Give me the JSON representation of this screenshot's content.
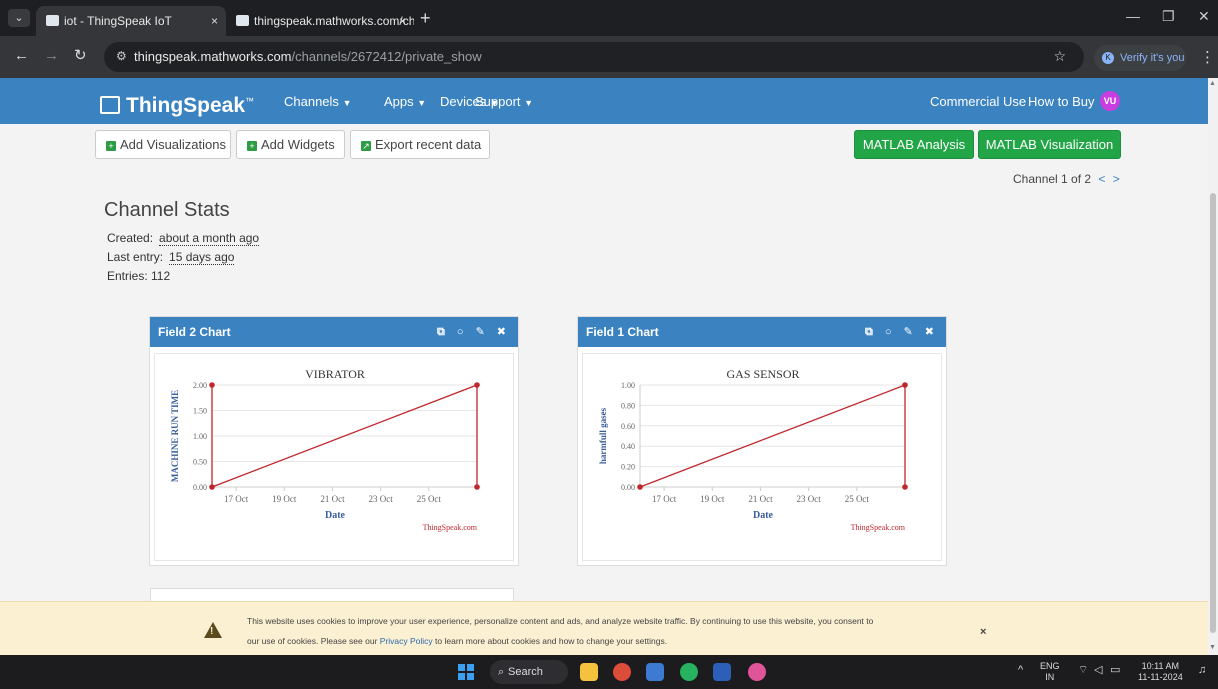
{
  "browser": {
    "tabs": [
      {
        "title": "iot - ThingSpeak IoT",
        "close": "×"
      },
      {
        "title": "thingspeak.mathworks.com/cha",
        "close": "×"
      }
    ],
    "new_tab": "+",
    "url_host": "thingspeak.mathworks.com",
    "url_path": "/channels/2672412/private_show",
    "verify_label": "Verify it's you",
    "verify_initial": "K"
  },
  "navbar": {
    "logo": "ThingSpeak",
    "logo_tm": "™",
    "menus": [
      "Channels",
      "Apps",
      "Devices",
      "Support"
    ],
    "commercial": "Commercial Use",
    "how_to_buy": "How to Buy",
    "avatar": "VU"
  },
  "toolbar": {
    "add_visualizations": "Add Visualizations",
    "add_widgets": "Add Widgets",
    "export": "Export recent data",
    "matlab_analysis": "MATLAB Analysis",
    "matlab_visualization": "MATLAB Visualization",
    "channel_nav": "Channel 1 of 2",
    "prev": "<",
    "next": ">"
  },
  "stats": {
    "title": "Channel Stats",
    "created_label": "Created:",
    "created_value": "about a month ago",
    "last_entry_label": "Last entry:",
    "last_entry_value": "15 days ago",
    "entries": "Entries: 112"
  },
  "chart_data": [
    {
      "type": "line",
      "panel_title": "Field 2 Chart",
      "title": "VIBRATOR",
      "xlabel": "Date",
      "ylabel": "MACHINE RUN TIME",
      "credit": "ThingSpeak.com",
      "x_ticks": [
        "17 Oct",
        "19 Oct",
        "21 Oct",
        "23 Oct",
        "25 Oct"
      ],
      "y_ticks": [
        "0.00",
        "0.50",
        "1.00",
        "1.50",
        "2.00"
      ],
      "ylim": [
        0,
        2
      ],
      "points": [
        {
          "x": "16 Oct",
          "y": 2
        },
        {
          "x": "16 Oct",
          "y": 0
        },
        {
          "x": "27 Oct",
          "y": 2
        },
        {
          "x": "27 Oct",
          "y": 0
        }
      ],
      "color": "#c0272d"
    },
    {
      "type": "line",
      "panel_title": "Field 1 Chart",
      "title": "GAS SENSOR",
      "xlabel": "Date",
      "ylabel": "harmfull gases",
      "credit": "ThingSpeak.com",
      "x_ticks": [
        "17 Oct",
        "19 Oct",
        "21 Oct",
        "23 Oct",
        "25 Oct"
      ],
      "y_ticks": [
        "0.00",
        "0.20",
        "0.40",
        "0.60",
        "0.80",
        "1.00"
      ],
      "ylim": [
        0,
        1
      ],
      "points": [
        {
          "x": "16 Oct",
          "y": 0
        },
        {
          "x": "27 Oct",
          "y": 1
        },
        {
          "x": "27 Oct",
          "y": 0
        }
      ],
      "color": "#c0272d"
    }
  ],
  "cookie": {
    "line1": "This website uses cookies to improve your user experience, personalize content and ads, and analyze website traffic. By continuing to use this website, you consent to",
    "line2_a": "our use of cookies. Please see our ",
    "line2_link": "Privacy Policy",
    "line2_b": " to learn more about cookies and how to change your settings.",
    "close": "×"
  },
  "taskbar": {
    "search": "Search",
    "lang_top": "ENG",
    "lang_bottom": "IN",
    "time": "10:11 AM",
    "date": "11-11-2024"
  }
}
